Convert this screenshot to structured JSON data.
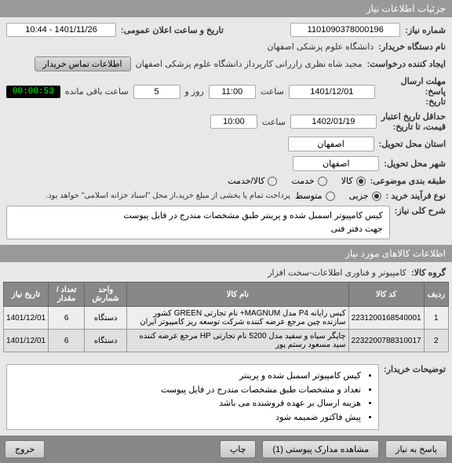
{
  "header": {
    "title": "جزئیات اطلاعات نیاز"
  },
  "fields": {
    "need_number": {
      "label": "شماره نیاز:",
      "value": "1101090378000196"
    },
    "announce": {
      "label": "تاریخ و ساعت اعلان عمومی:",
      "value": "1401/11/26 - 10:44"
    },
    "buyer": {
      "label": "نام دستگاه خریدار:",
      "value": "دانشگاه علوم پزشکی اصفهان"
    },
    "requester": {
      "label": "ایجاد کننده درخواست:",
      "value": "مجید شاه نظری زازرانی کارپرداز دانشگاه علوم پزشکی اصفهان"
    },
    "contact_btn": "اطلاعات تماس خریدار",
    "deadline": {
      "label": "مهلت ارسال پاسخ:\nتاریخ:",
      "date": "1401/12/01",
      "time_label": "ساعت",
      "time": "11:00",
      "daydur_label": "روز و",
      "days": "5",
      "remain_label": "ساعت باقی مانده",
      "remain": "00:00:53"
    },
    "validity": {
      "label": "حداقل تاریخ اعتبار\nقیمت، تا تاریخ:",
      "date": "1402/01/19",
      "time_label": "ساعت",
      "time": "10:00"
    },
    "province": {
      "label": "استان محل تحویل:",
      "value": "اصفهان"
    },
    "city": {
      "label": "شهر محل تحویل:",
      "value": "اصفهان"
    },
    "category": {
      "label": "طبقه بندی موضوعی:",
      "options": [
        "کالا",
        "خدمت",
        "کالا/خدمت"
      ],
      "selected": 0
    },
    "purchase_type": {
      "label": "نوع فرآیند خرید :",
      "options": [
        "جزیی",
        "متوسط"
      ],
      "selected": 0,
      "note": "پرداخت تمام یا بخشی از مبلغ خرید،از محل \"اسناد خزانه اسلامی\" خواهد بود."
    }
  },
  "description": {
    "label": "شرح کلی نیاز:",
    "text1": "کیس کامپیوتر اسمبل شده و پرینتر طبق مشخصات مندرج در فایل پیوست",
    "text2": "جهت دفتر فنی"
  },
  "items_section": {
    "header": "اطلاعات کالاهای مورد نیاز",
    "group": {
      "label": "گروه کالا:",
      "value": "کامپیوتر و فناوری اطلاعات-سخت افزار"
    }
  },
  "table": {
    "headers": [
      "ردیف",
      "کد کالا",
      "نام کالا",
      "واحد شمارش",
      "تعداد / مقدار",
      "تاریخ نیاز"
    ],
    "rows": [
      {
        "r": "1",
        "code": "2231200168540001",
        "name": "کیس رایانه P4 مدل MAGNUM+ نام تجارتی GREEN کشور سازنده چین مرجع عرضه کننده شرکت توسعه ریز کامپیوتر ایران",
        "unit": "دستگاه",
        "qty": "6",
        "date": "1401/12/01"
      },
      {
        "r": "2",
        "code": "2232200788310017",
        "name": "چاپگر سیاه و سفید مدل 5200 نام تجارتی HP مرجع عرضه کننده سید مسعود رستم پور",
        "unit": "دستگاه",
        "qty": "6",
        "date": "1401/12/01"
      }
    ]
  },
  "notes": {
    "label": "توضیحات خریدار:",
    "items": [
      "کیس کامپیوتر اسمبل شده و پرینتر",
      "تعداد و مشخصات طبق مشخصات مندرج در فایل پیوست",
      "هزینه ارسال بر عهده فروشنده می باشد",
      "پیش فاکتور ضمیمه شود"
    ]
  },
  "footer": {
    "reply": "پاسخ به نیاز",
    "attachments": "مشاهده مدارک پیوستی (1)",
    "print": "چاپ",
    "exit": "خروج"
  }
}
